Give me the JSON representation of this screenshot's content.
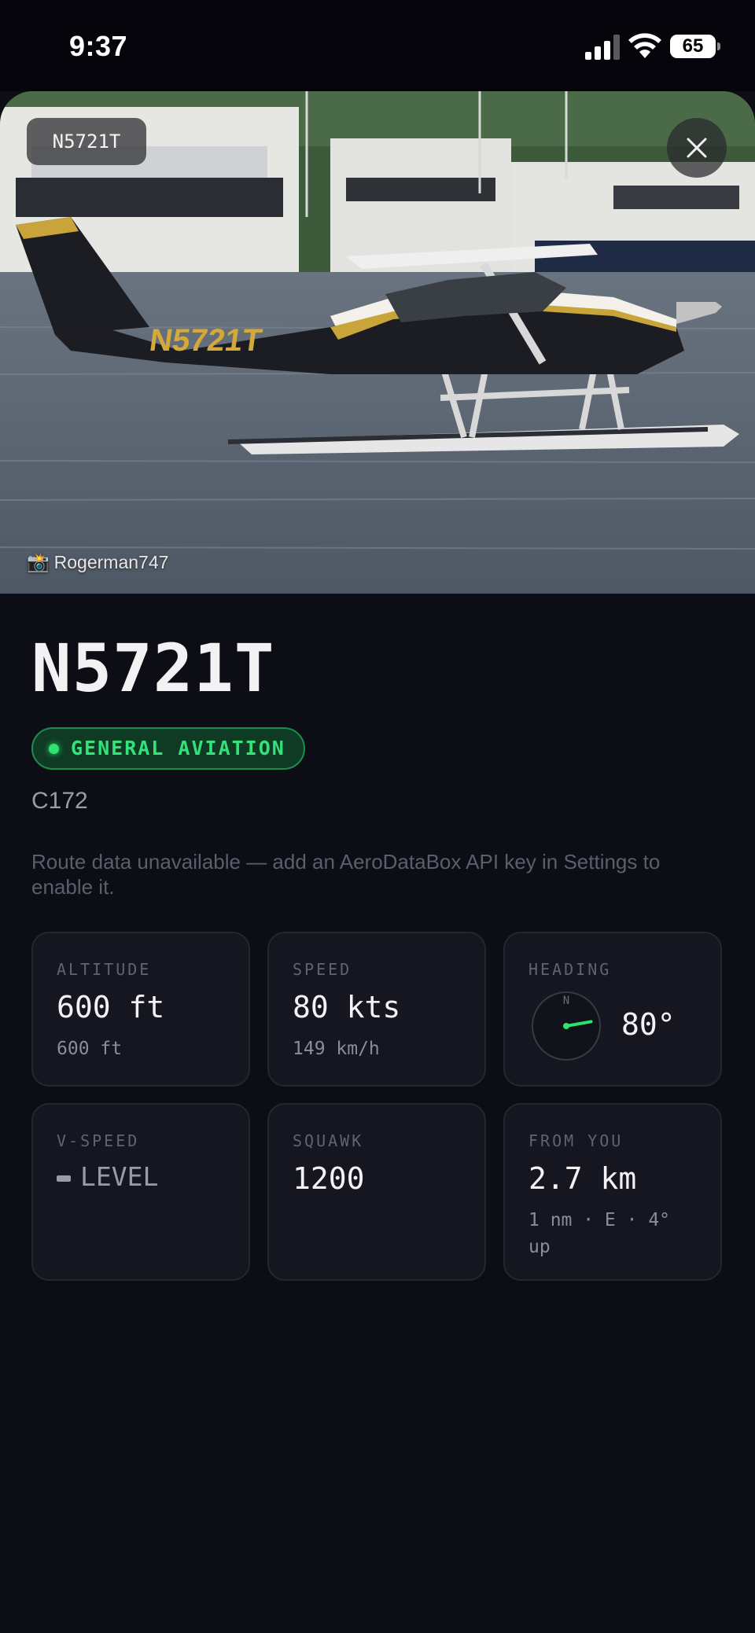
{
  "status_bar": {
    "time": "9:37",
    "battery": "65",
    "icons": [
      "cellular-signal-icon",
      "wifi-icon",
      "battery-icon"
    ]
  },
  "hero": {
    "tag": "N5721T",
    "photo_credit": "Rogerman747",
    "camera_icon": "📸"
  },
  "aircraft": {
    "callsign": "N5721T",
    "category": "GENERAL AVIATION",
    "type": "C172",
    "route_note": "Route data unavailable — add an AeroDataBox API key in Settings to enable it."
  },
  "cards": {
    "altitude": {
      "label": "ALTITUDE",
      "value": "600 ft",
      "sub": "600 ft"
    },
    "speed": {
      "label": "SPEED",
      "value": "80 kts",
      "sub": "149 km/h"
    },
    "heading": {
      "label": "HEADING",
      "value": "80°",
      "compass_letter": "N",
      "degrees": 80
    },
    "vspeed": {
      "label": "V-SPEED",
      "value": "LEVEL"
    },
    "squawk": {
      "label": "SQUAWK",
      "value": "1200"
    },
    "distance": {
      "label": "FROM YOU",
      "value": "2.7 km",
      "sub": "1 nm · E · 4° up"
    }
  },
  "colors": {
    "background": "#0d0d16",
    "card": "#161620",
    "accent_green": "#33e37a"
  }
}
